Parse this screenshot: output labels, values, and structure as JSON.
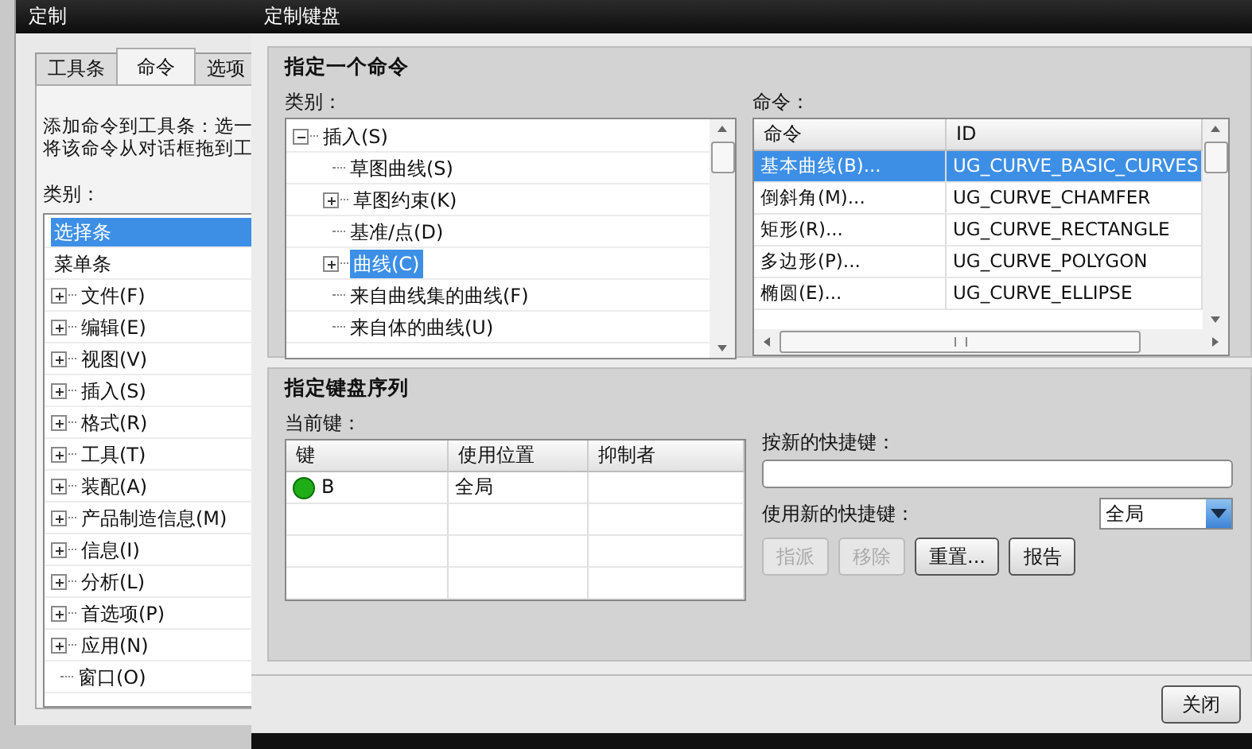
{
  "back_window": {
    "title": "定制",
    "tabs": [
      {
        "label": "工具条",
        "selected": false
      },
      {
        "label": "命令",
        "selected": true
      },
      {
        "label": "选项",
        "selected": false
      }
    ],
    "instructions": [
      "添加命令到工具条：选一",
      "将该命令从对话框拖到工"
    ],
    "category_label": "类别：",
    "categories": [
      {
        "label": "选择条",
        "kind": "leaf",
        "selected": true
      },
      {
        "label": "菜单条",
        "kind": "leaf",
        "selected": false
      },
      {
        "label": "文件(F)",
        "kind": "branch",
        "expanded": false,
        "selected": false
      },
      {
        "label": "编辑(E)",
        "kind": "branch",
        "expanded": false,
        "selected": false
      },
      {
        "label": "视图(V)",
        "kind": "branch",
        "expanded": false,
        "selected": false
      },
      {
        "label": "插入(S)",
        "kind": "branch",
        "expanded": false,
        "selected": false
      },
      {
        "label": "格式(R)",
        "kind": "branch",
        "expanded": false,
        "selected": false
      },
      {
        "label": "工具(T)",
        "kind": "branch",
        "expanded": false,
        "selected": false
      },
      {
        "label": "装配(A)",
        "kind": "branch",
        "expanded": false,
        "selected": false
      },
      {
        "label": "产品制造信息(M)",
        "kind": "branch",
        "expanded": false,
        "selected": false
      },
      {
        "label": "信息(I)",
        "kind": "branch",
        "expanded": false,
        "selected": false
      },
      {
        "label": "分析(L)",
        "kind": "branch",
        "expanded": false,
        "selected": false
      },
      {
        "label": "首选项(P)",
        "kind": "branch",
        "expanded": false,
        "selected": false
      },
      {
        "label": "应用(N)",
        "kind": "branch",
        "expanded": false,
        "selected": false
      },
      {
        "label": "窗口(O)",
        "kind": "twig",
        "selected": false
      }
    ]
  },
  "keyboard_dialog": {
    "title": "定制键盘",
    "command_group": {
      "title": "指定一个命令",
      "category_label": "类别：",
      "category_tree": [
        {
          "label": "插入(S)",
          "kind": "branch",
          "expanded": true,
          "selected": false,
          "children": [
            {
              "label": "草图曲线(S)",
              "kind": "leaf",
              "selected": false
            },
            {
              "label": "草图约束(K)",
              "kind": "branch",
              "expanded": false,
              "selected": false
            },
            {
              "label": "基准/点(D)",
              "kind": "leaf",
              "selected": false
            },
            {
              "label": "曲线(C)",
              "kind": "branch",
              "expanded": false,
              "selected": true
            },
            {
              "label": "来自曲线集的曲线(F)",
              "kind": "leaf",
              "selected": false
            },
            {
              "label": "来自体的曲线(U)",
              "kind": "leaf",
              "selected": false
            }
          ]
        }
      ],
      "commands_label": "命令：",
      "commands_table": {
        "columns": [
          "命令",
          "ID"
        ],
        "rows": [
          {
            "cells": [
              "基本曲线(B)...",
              "UG_CURVE_BASIC_CURVES"
            ],
            "selected": true
          },
          {
            "cells": [
              "倒斜角(M)...",
              "UG_CURVE_CHAMFER"
            ],
            "selected": false
          },
          {
            "cells": [
              "矩形(R)...",
              "UG_CURVE_RECTANGLE"
            ],
            "selected": false
          },
          {
            "cells": [
              "多边形(P)...",
              "UG_CURVE_POLYGON"
            ],
            "selected": false
          },
          {
            "cells": [
              "椭圆(E)...",
              "UG_CURVE_ELLIPSE"
            ],
            "selected": false
          }
        ]
      }
    },
    "sequence_group": {
      "title": "指定键盘序列",
      "current_keys_label": "当前键：",
      "keys_table": {
        "columns": [
          "键",
          "使用位置",
          "抑制者"
        ],
        "rows": [
          {
            "cells": [
              "B",
              "全局",
              ""
            ]
          }
        ]
      },
      "new_shortcut_label": "按新的快捷键：",
      "use_new_label": "使用新的快捷键：",
      "scope_dropdown": {
        "value": "全局"
      },
      "buttons": [
        {
          "label": "指派",
          "disabled": true
        },
        {
          "label": "移除",
          "disabled": true
        },
        {
          "label": "重置...",
          "disabled": false
        },
        {
          "label": "报告",
          "disabled": false
        }
      ]
    },
    "close_button": "关闭"
  }
}
